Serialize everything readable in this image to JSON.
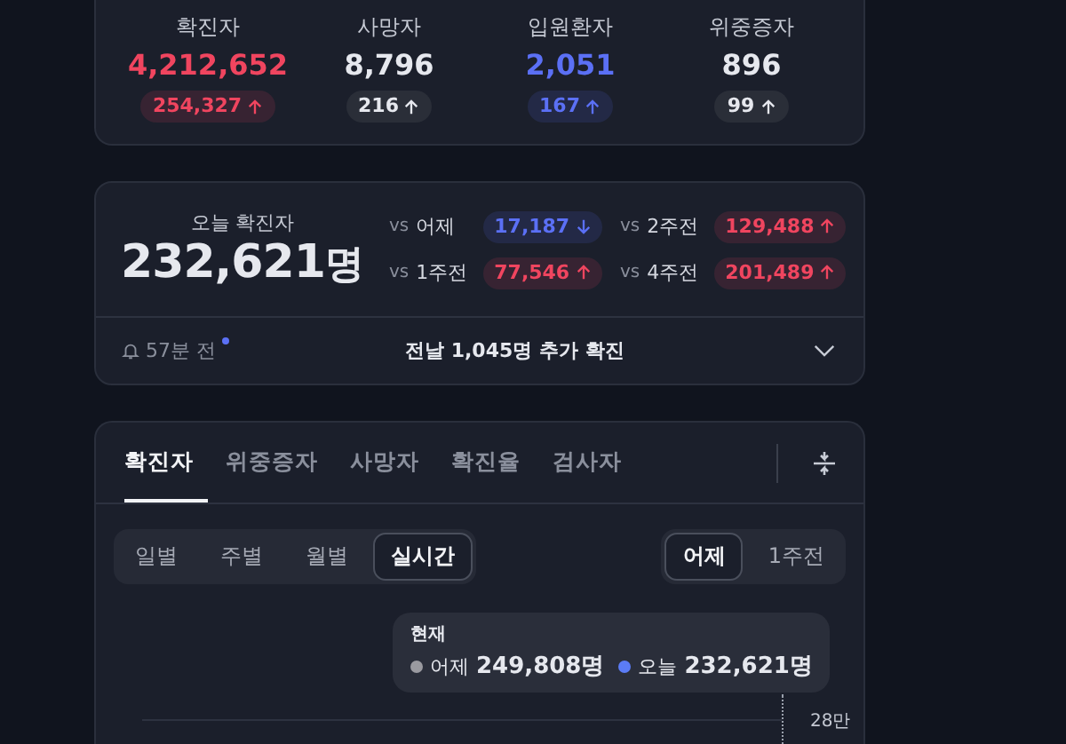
{
  "stats": [
    {
      "label": "확진자",
      "value": "4,212,652",
      "color": "#f0455f",
      "delta": {
        "value": "254,327",
        "rising": true
      }
    },
    {
      "label": "사망자",
      "value": "8,796",
      "color": "#e6e8ee",
      "delta": {
        "value": "216",
        "rising": true
      }
    },
    {
      "label": "입원환자",
      "value": "2,051",
      "color": "#5b70f5",
      "delta": {
        "value": "167",
        "rising": true
      }
    },
    {
      "label": "위중증자",
      "value": "896",
      "color": "#e6e8ee",
      "delta": {
        "value": "99",
        "rising": true
      }
    }
  ],
  "today": {
    "label": "오늘 확진자",
    "value": "232,621",
    "unit": "명",
    "comparisons": [
      {
        "prefix": "vs",
        "label": "어제",
        "value": "17,187",
        "rising": false,
        "color": "#5b70f5"
      },
      {
        "prefix": "vs",
        "label": "2주전",
        "value": "129,488",
        "rising": true,
        "color": "#f0455f"
      },
      {
        "prefix": "vs",
        "label": "1주전",
        "value": "77,546",
        "rising": true,
        "color": "#f0455f"
      },
      {
        "prefix": "vs",
        "label": "4주전",
        "value": "201,489",
        "rising": true,
        "color": "#f0455f"
      }
    ],
    "footer": {
      "time": "57분 전",
      "unread": true,
      "message": "전날 1,045명 추가 확진"
    }
  },
  "tabs": [
    {
      "label": "확진자",
      "selected": true
    },
    {
      "label": "위중증자",
      "selected": false
    },
    {
      "label": "사망자",
      "selected": false
    },
    {
      "label": "확진율",
      "selected": false
    },
    {
      "label": "검사자",
      "selected": false
    }
  ],
  "period_tabs": [
    {
      "label": "일별",
      "selected": false
    },
    {
      "label": "주별",
      "selected": false
    },
    {
      "label": "월별",
      "selected": false
    },
    {
      "label": "실시간",
      "selected": true
    }
  ],
  "compare_tabs": [
    {
      "label": "어제",
      "selected": true
    },
    {
      "label": "1주전",
      "selected": false
    }
  ],
  "tooltip": {
    "title": "현재",
    "entries": [
      {
        "label": "어제",
        "value": "249,808명",
        "color": "#9a9aa0"
      },
      {
        "label": "오늘",
        "value": "232,621명",
        "color": "#5b7cf5"
      }
    ]
  },
  "chart": {
    "y_tick": "28만"
  }
}
